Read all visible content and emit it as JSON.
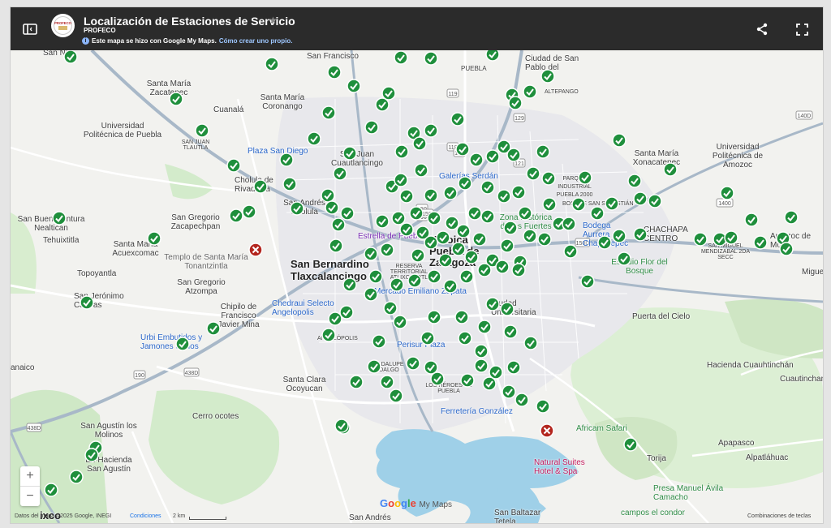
{
  "header": {
    "title": "Localización de Estaciones de Servicio",
    "subtitle": "PROFECO",
    "info_text": "Este mapa se hizo con Google My Maps.",
    "info_link": "Cómo crear uno propio."
  },
  "colors": {
    "topbar": "#2b2b2b",
    "marker_ok": "#1f8f3c",
    "marker_bad": "#b3261e",
    "road_major": "#ffffff",
    "road_highway": "#a8b8c8",
    "water": "#9fd0e8",
    "park": "#c8e6c0"
  },
  "icons": {
    "panel_toggle": "panel-toggle-icon",
    "share": "share-icon",
    "fullscreen": "fullscreen-icon",
    "marker_ok": "check-marker-icon",
    "marker_bad": "x-marker-icon"
  },
  "map": {
    "labels": {
      "san_pablo": "Ciudad de San Pablo del",
      "altepango": "ALTEPANGO",
      "puebla_road": "PUEBLA",
      "san_francisco": "San Francisco",
      "santa_maria_zacatepec": "Santa María Zacatepec",
      "santa_maria_coronango": "Santa María Coronango",
      "cuanala": "Cuanalá",
      "universidad_politecnica": "Universidad Politécnica de Puebla",
      "san_juan_tlautla": "SAN JUAN TLAUTLA",
      "plaza_san_diego": "Plaza San Diego",
      "cuautlancingo": "San Juan Cuautlancingo",
      "cholula": "Cholula de Rivadavia",
      "san_andres_cholula": "San Andrés Cholula",
      "galerias": "Galerías Serdán",
      "parque_industrial": "PARQUE INDUSTRIAL PUEBLA 2000",
      "bosque_san_sebastian": "BOSQUE SAN SEBASTIÁN",
      "santa_maria_xonacatepec": "Santa María Xonacatepec",
      "univ_amozoc": "Universidad Politécnica de Amozoc",
      "san_buenaventura": "San Buenaventura Nealtican",
      "tehuixtitla": "Tehuixtitla",
      "san_gregorio_zacapechpan": "San Gregorio Zacapechpan",
      "santa_maria_acuexcomac": "Santa María Acuexcomac",
      "templo": "Templo de Santa María Tonantzintla",
      "toyoantla": "Topoyantla",
      "estrella": "Estrella de Puebla",
      "heroica_puebla": "Heroica Puebla de Zaragoza",
      "zona_historica": "Zona Histórica de los Fuertes",
      "bodega": "Bodega Aurrera Chapultepec",
      "chachapa": "CHACHAPA CENTRO",
      "amozoc": "Amozoc de Mota",
      "san_bernardino": "San Bernardino Tlaxcalancingo",
      "san_gregorio_atzompa": "San Gregorio Atzompa",
      "reserva": "RESERVA TERRITORIAL ATLIXCAYOTL",
      "mercado": "Mercado Emiliano Zapata",
      "ciudad_universitaria": "Ciudad Universitaria",
      "estadio": "Estadio Flor del Bosque",
      "puerta_cielo": "Puerta del Cielo",
      "san_jeronimo": "San Jerónimo Caleras",
      "chipilo": "Chipilo de Francisco Javier Mina",
      "chedraui": "Chedraui Selecto Angelopolis",
      "angelopolis": "ANGELÓPOLIS",
      "urbi": "Urbi Embutidos y Jamones Serios",
      "perisur": "Perisur Plaza",
      "hacienda": "Hacienda Cuauhtinchán",
      "guadalupe": "GUADALUPE HIDALGO",
      "heroes": "LOS HÉROES DE PUEBLA",
      "santa_clara": "Santa Clara Ocoyucan",
      "ferreteria": "Ferretería González",
      "cerro": "Cerro ocotes",
      "africam": "Africam Safari",
      "san_agustin": "San Agustín los Molinos",
      "ex_hacienda": "Ex-Hacienda San Agustín",
      "natural_suites": "Natural Suites Hotel & Spa",
      "presa": "Presa Manuel Ávila Camacho",
      "apapasco": "Apapasco",
      "alpatlahuac": "Alpatláhuac",
      "torija": "Torija",
      "cuautinchan": "Cuautinchan",
      "san_baltazar": "San Baltazar Tetela",
      "san_andres": "San Andrés",
      "campos_condor": "campos el condor",
      "anaico": "anaico",
      "mendizabal": "SAN MIGUEL MENDIZABAL 2DA SECC",
      "texco": "ixco",
      "centro_miguel": "Miguel",
      "san_nic": "San Nic"
    }
  },
  "markers": [
    [
      86,
      69,
      "ok"
    ],
    [
      334,
      78,
      "ok"
    ],
    [
      411,
      88,
      "ok"
    ],
    [
      435,
      105,
      "ok"
    ],
    [
      493,
      70,
      "ok"
    ],
    [
      530,
      71,
      "ok"
    ],
    [
      606,
      66,
      "ok"
    ],
    [
      674,
      93,
      "ok"
    ],
    [
      652,
      112,
      "ok"
    ],
    [
      630,
      116,
      "ok"
    ],
    [
      634,
      126,
      "ok"
    ],
    [
      216,
      121,
      "ok"
    ],
    [
      404,
      138,
      "ok"
    ],
    [
      470,
      128,
      "ok"
    ],
    [
      478,
      114,
      "ok"
    ],
    [
      457,
      156,
      "ok"
    ],
    [
      563,
      146,
      "ok"
    ],
    [
      248,
      160,
      "ok"
    ],
    [
      386,
      170,
      "ok"
    ],
    [
      509,
      163,
      "ok"
    ],
    [
      530,
      160,
      "ok"
    ],
    [
      762,
      172,
      "ok"
    ],
    [
      287,
      203,
      "ok"
    ],
    [
      352,
      196,
      "ok"
    ],
    [
      430,
      188,
      "ok"
    ],
    [
      418,
      213,
      "ok"
    ],
    [
      494,
      186,
      "ok"
    ],
    [
      516,
      176,
      "ok"
    ],
    [
      518,
      209,
      "ok"
    ],
    [
      569,
      183,
      "ok"
    ],
    [
      586,
      196,
      "ok"
    ],
    [
      606,
      192,
      "ok"
    ],
    [
      620,
      180,
      "ok"
    ],
    [
      632,
      190,
      "ok"
    ],
    [
      668,
      186,
      "ok"
    ],
    [
      356,
      226,
      "ok"
    ],
    [
      320,
      229,
      "ok"
    ],
    [
      403,
      240,
      "ok"
    ],
    [
      482,
      229,
      "ok"
    ],
    [
      493,
      221,
      "ok"
    ],
    [
      500,
      241,
      "ok"
    ],
    [
      530,
      240,
      "ok"
    ],
    [
      554,
      237,
      "ok"
    ],
    [
      572,
      225,
      "ok"
    ],
    [
      600,
      230,
      "ok"
    ],
    [
      620,
      241,
      "ok"
    ],
    [
      638,
      236,
      "ok"
    ],
    [
      656,
      213,
      "ok"
    ],
    [
      675,
      219,
      "ok"
    ],
    [
      720,
      218,
      "ok"
    ],
    [
      781,
      222,
      "ok"
    ],
    [
      825,
      208,
      "ok"
    ],
    [
      290,
      265,
      "ok"
    ],
    [
      306,
      260,
      "ok"
    ],
    [
      365,
      256,
      "ok"
    ],
    [
      408,
      255,
      "ok"
    ],
    [
      427,
      262,
      "ok"
    ],
    [
      470,
      272,
      "ok"
    ],
    [
      490,
      268,
      "ok"
    ],
    [
      512,
      262,
      "ok"
    ],
    [
      534,
      268,
      "ok"
    ],
    [
      556,
      274,
      "ok"
    ],
    [
      584,
      262,
      "ok"
    ],
    [
      600,
      266,
      "ok"
    ],
    [
      646,
      262,
      "ok"
    ],
    [
      676,
      251,
      "ok"
    ],
    [
      712,
      251,
      "ok"
    ],
    [
      735,
      262,
      "ok"
    ],
    [
      753,
      250,
      "ok"
    ],
    [
      788,
      244,
      "ok"
    ],
    [
      806,
      247,
      "ok"
    ],
    [
      895,
      237,
      "ok"
    ],
    [
      72,
      268,
      "ok"
    ],
    [
      416,
      276,
      "ok"
    ],
    [
      500,
      282,
      "ok"
    ],
    [
      520,
      286,
      "ok"
    ],
    [
      545,
      292,
      "ok"
    ],
    [
      570,
      284,
      "ok"
    ],
    [
      590,
      294,
      "ok"
    ],
    [
      628,
      280,
      "ok"
    ],
    [
      652,
      290,
      "ok"
    ],
    [
      670,
      294,
      "ok"
    ],
    [
      688,
      275,
      "ok"
    ],
    [
      700,
      275,
      "ok"
    ],
    [
      744,
      298,
      "ok"
    ],
    [
      762,
      290,
      "ok"
    ],
    [
      788,
      288,
      "ok"
    ],
    [
      862,
      294,
      "ok"
    ],
    [
      886,
      294,
      "ok"
    ],
    [
      900,
      292,
      "ok"
    ],
    [
      925,
      270,
      "ok"
    ],
    [
      936,
      298,
      "ok"
    ],
    [
      964,
      293,
      "ok"
    ],
    [
      968,
      306,
      "ok"
    ],
    [
      974,
      267,
      "ok"
    ],
    [
      189,
      293,
      "ok"
    ],
    [
      413,
      302,
      "ok"
    ],
    [
      456,
      312,
      "ok"
    ],
    [
      476,
      307,
      "ok"
    ],
    [
      514,
      314,
      "ok"
    ],
    [
      530,
      298,
      "ok"
    ],
    [
      548,
      320,
      "ok"
    ],
    [
      564,
      306,
      "ok"
    ],
    [
      580,
      316,
      "ok"
    ],
    [
      606,
      320,
      "ok"
    ],
    [
      624,
      302,
      "ok"
    ],
    [
      640,
      322,
      "ok"
    ],
    [
      702,
      309,
      "ok"
    ],
    [
      768,
      318,
      "ok"
    ],
    [
      430,
      350,
      "ok"
    ],
    [
      462,
      340,
      "ok"
    ],
    [
      488,
      350,
      "ok"
    ],
    [
      510,
      345,
      "ok"
    ],
    [
      534,
      340,
      "ok"
    ],
    [
      554,
      352,
      "ok"
    ],
    [
      574,
      340,
      "ok"
    ],
    [
      596,
      332,
      "ok"
    ],
    [
      618,
      328,
      "ok"
    ],
    [
      638,
      332,
      "ok"
    ],
    [
      723,
      346,
      "ok"
    ],
    [
      106,
      372,
      "ok"
    ],
    [
      456,
      362,
      "ok"
    ],
    [
      480,
      379,
      "ok"
    ],
    [
      426,
      384,
      "ok"
    ],
    [
      412,
      392,
      "ok"
    ],
    [
      534,
      390,
      "ok"
    ],
    [
      568,
      390,
      "ok"
    ],
    [
      606,
      374,
      "ok"
    ],
    [
      624,
      380,
      "ok"
    ],
    [
      262,
      404,
      "ok"
    ],
    [
      404,
      412,
      "ok"
    ],
    [
      492,
      396,
      "ok"
    ],
    [
      526,
      416,
      "ok"
    ],
    [
      572,
      416,
      "ok"
    ],
    [
      596,
      402,
      "ok"
    ],
    [
      628,
      408,
      "ok"
    ],
    [
      466,
      420,
      "ok"
    ],
    [
      224,
      423,
      "ok"
    ],
    [
      653,
      422,
      "ok"
    ],
    [
      460,
      451,
      "ok"
    ],
    [
      508,
      447,
      "ok"
    ],
    [
      530,
      452,
      "ok"
    ],
    [
      592,
      432,
      "ok"
    ],
    [
      592,
      450,
      "ok"
    ],
    [
      610,
      458,
      "ok"
    ],
    [
      632,
      452,
      "ok"
    ],
    [
      438,
      470,
      "ok"
    ],
    [
      476,
      470,
      "ok"
    ],
    [
      538,
      466,
      "ok"
    ],
    [
      575,
      468,
      "ok"
    ],
    [
      602,
      472,
      "ok"
    ],
    [
      487,
      487,
      "ok"
    ],
    [
      626,
      482,
      "ok"
    ],
    [
      642,
      492,
      "ok"
    ],
    [
      668,
      500,
      "ok"
    ],
    [
      422,
      526,
      "ok"
    ],
    [
      420,
      524,
      "ok"
    ],
    [
      117,
      551,
      "ok"
    ],
    [
      112,
      560,
      "ok"
    ],
    [
      93,
      587,
      "ok"
    ],
    [
      62,
      603,
      "ok"
    ],
    [
      776,
      547,
      "ok"
    ],
    [
      314,
      307,
      "bad"
    ],
    [
      673,
      530,
      "bad"
    ]
  ]
}
